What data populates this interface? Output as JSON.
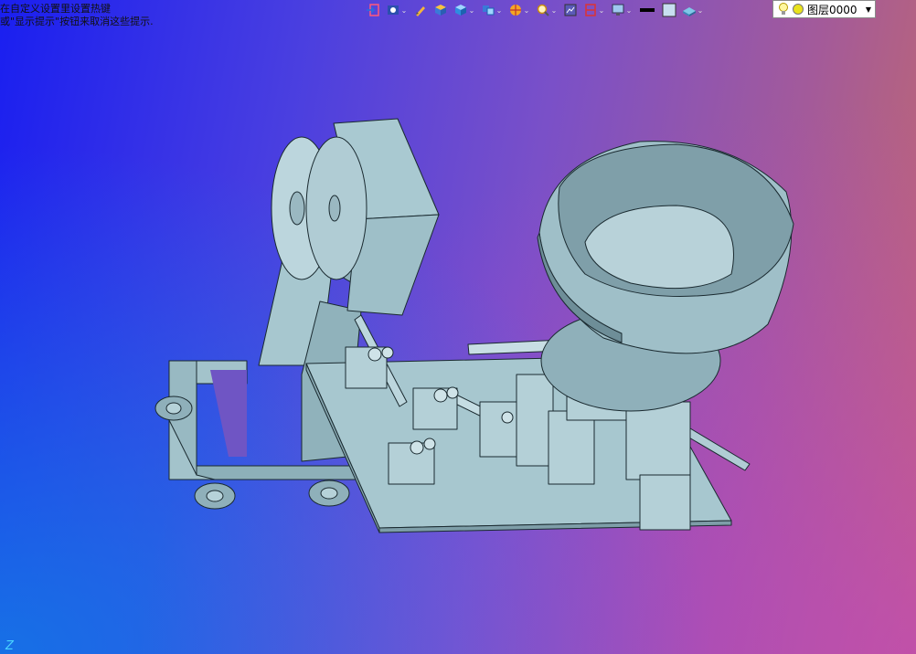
{
  "hint": {
    "line1": "在自定义设置里设置热键",
    "line2": "或\"显示提示\"按钮来取消这些提示."
  },
  "toolbar": {
    "items": [
      {
        "icon": "exit-icon"
      },
      {
        "icon": "view-icon",
        "dropdown": true
      },
      {
        "icon": "pen-icon"
      },
      {
        "icon": "layer-box-icon"
      },
      {
        "icon": "cube-icon",
        "dropdown": true
      },
      {
        "icon": "views-icon",
        "dropdown": true
      },
      {
        "icon": "render-icon",
        "dropdown": true
      },
      {
        "icon": "zoom-icon",
        "dropdown": true
      },
      {
        "icon": "display-icon"
      },
      {
        "icon": "section-icon",
        "dropdown": true
      },
      {
        "icon": "monitor-icon",
        "dropdown": true
      },
      {
        "icon": "line-color-icon"
      },
      {
        "icon": "fill-color-icon"
      },
      {
        "icon": "surface-icon",
        "dropdown": true
      }
    ],
    "colors": {
      "line": "#000000",
      "fill": "#c8dff0"
    }
  },
  "layer": {
    "name": "图层0000"
  },
  "axis_label": "Z",
  "colors": {
    "part_fill": "#a7c7cf",
    "part_dark": "#8fb0ba",
    "part_edge": "#1a2a30"
  }
}
